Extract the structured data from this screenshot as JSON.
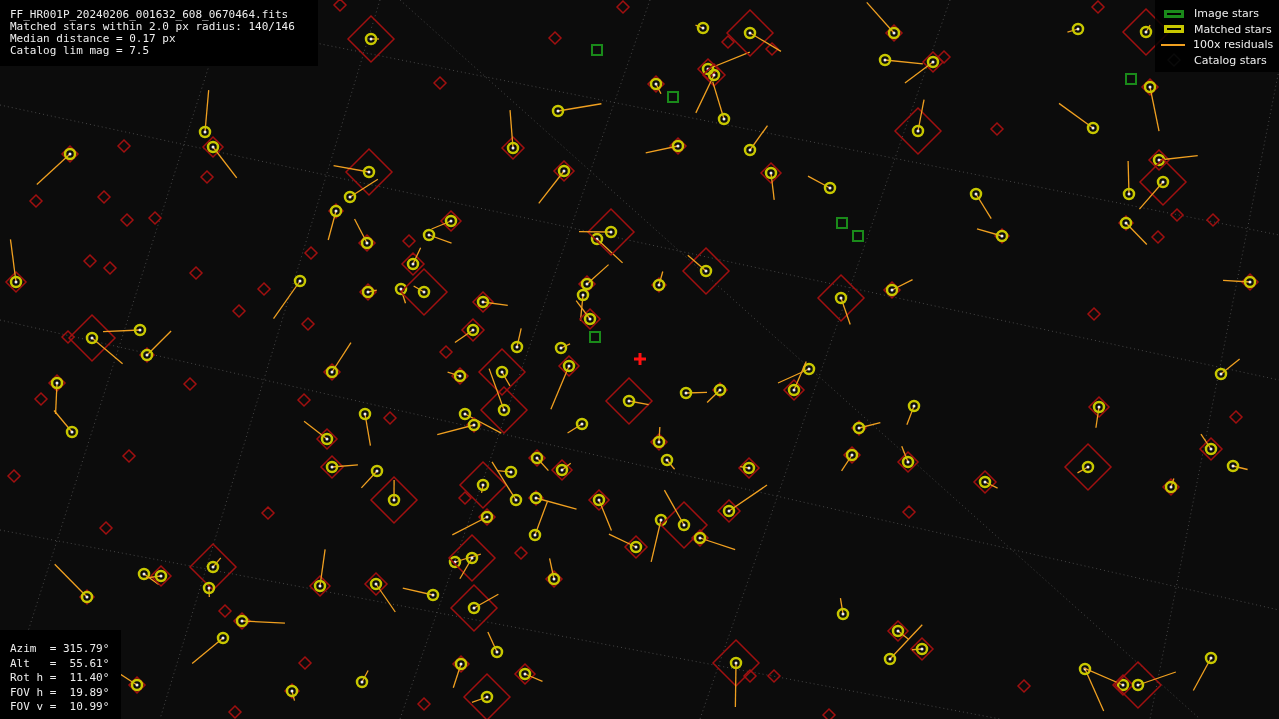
{
  "info_lines": [
    "FF_HR001P_20240206_001632_608_0670464.fits",
    "Matched stars within 2.0 px radius: 140/146",
    "Median distance = 0.17 px",
    "Catalog lim mag = 7.5"
  ],
  "legend": [
    {
      "kind": "image",
      "label": "Image stars"
    },
    {
      "kind": "matched",
      "label": "Matched stars"
    },
    {
      "kind": "residual",
      "label": "100x residuals"
    },
    {
      "kind": "catalog",
      "label": "Catalog stars"
    }
  ],
  "pointing_lines": [
    "Azim  = 315.79°",
    "Alt   =  55.61°",
    "Rot h =  11.40°",
    "FOV h =  19.89°",
    "FOV v =  10.99°"
  ]
}
